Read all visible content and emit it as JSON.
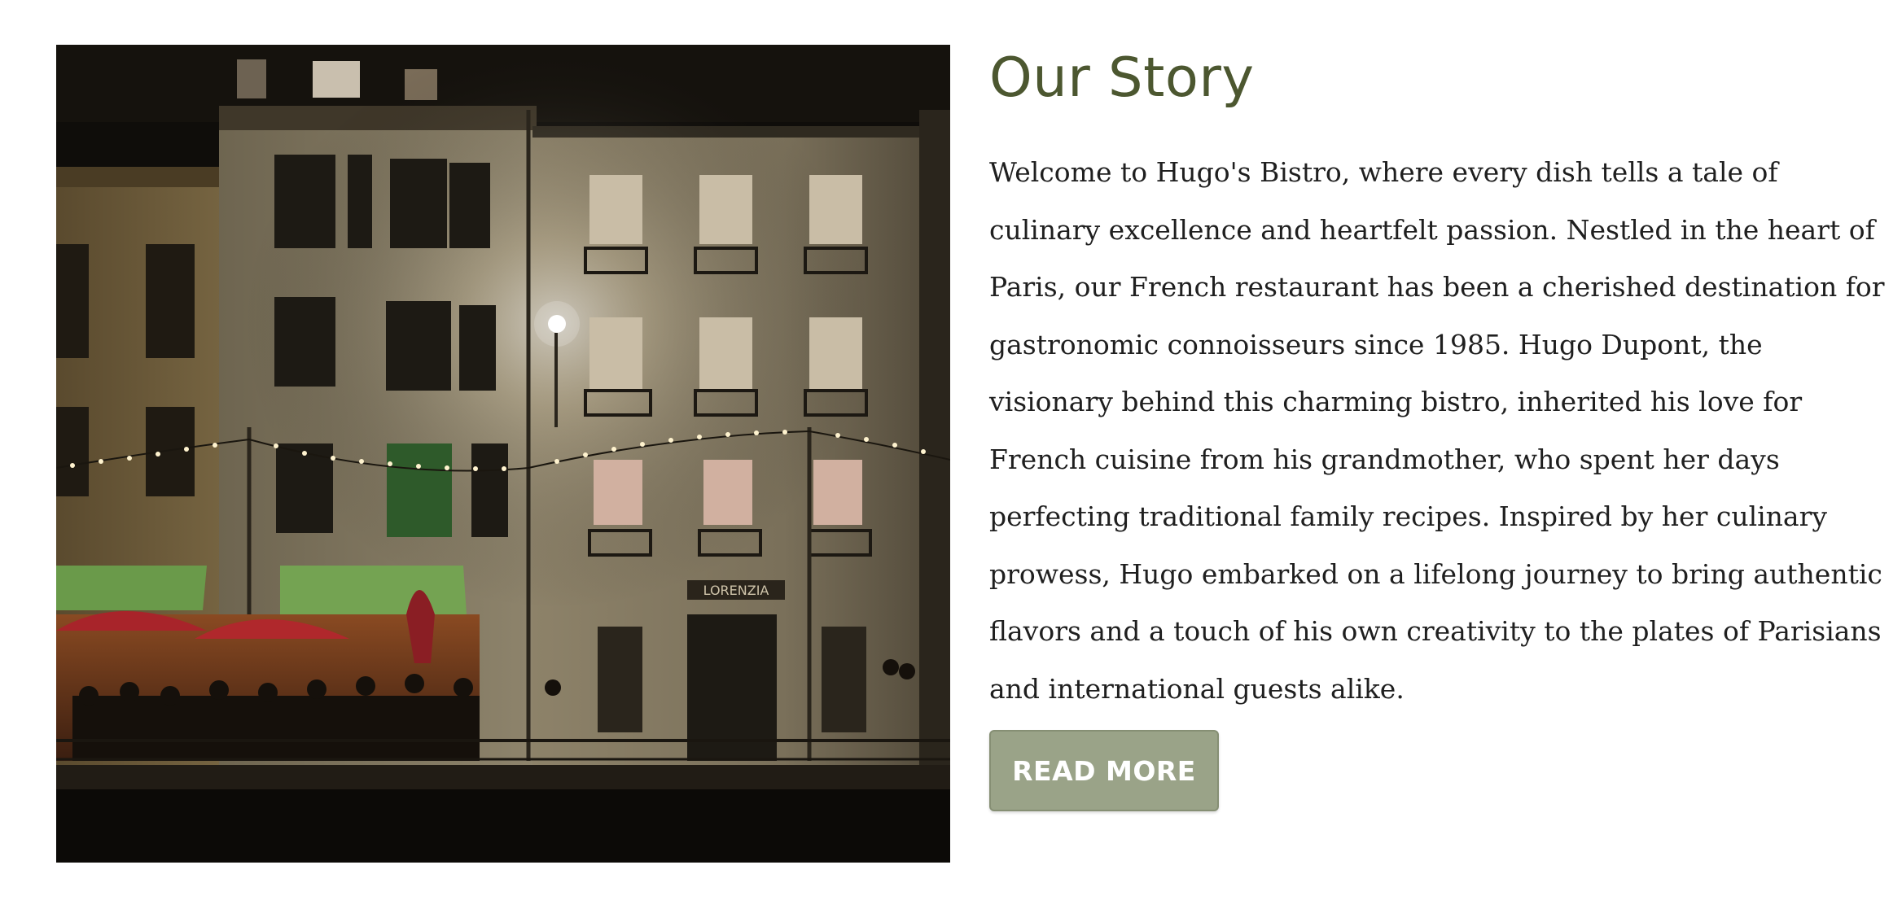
{
  "photo": {
    "alt": "Night view of a Parisian building facade with restaurant terraces, string lights and red umbrellas",
    "shop_sign": "LORENZIA"
  },
  "story": {
    "title": "Our Story",
    "body": "Welcome to Hugo's Bistro, where every dish tells a tale of culinary excellence and heartfelt passion. Nestled in the heart of Paris, our French restaurant has been a cherished destination for gastronomic connoisseurs since 1985. Hugo Dupont, the visionary behind this charming bistro, inherited his love for French cuisine from his grandmother, who spent her days perfecting traditional family recipes. Inspired by her culinary prowess, Hugo embarked on a lifelong journey to bring authentic flavors and a touch of his own creativity to the plates of Parisians and international guests alike.",
    "button_label": "READ MORE"
  },
  "colors": {
    "title": "#4c5730",
    "body_text": "#1f1f1f",
    "button_bg": "#9aa388",
    "button_text": "#ffffff"
  }
}
